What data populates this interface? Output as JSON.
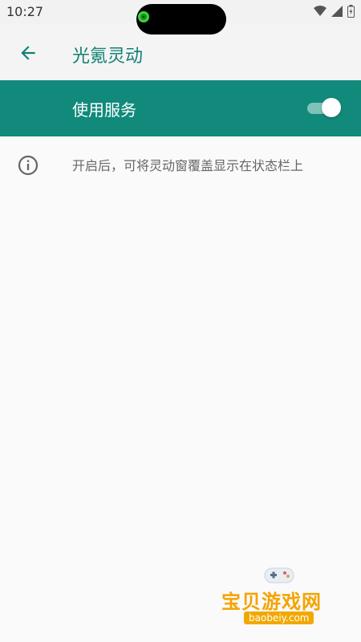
{
  "status_bar": {
    "time": "10:27",
    "icons": [
      "wifi-icon",
      "signal-icon",
      "battery-icon"
    ]
  },
  "app_bar": {
    "title": "光氪灵动",
    "back_icon": "arrow-back-icon"
  },
  "service_switch": {
    "label": "使用服务",
    "enabled": true
  },
  "info": {
    "icon": "info-icon",
    "text": "开启后，可将灵动窗覆盖显示在状态栏上"
  },
  "watermark": {
    "brand": "宝贝游戏网",
    "domain": "baobeiy.com"
  },
  "colors": {
    "primary": "#118a7c",
    "title": "#0f7f73",
    "background": "#fafafa"
  }
}
